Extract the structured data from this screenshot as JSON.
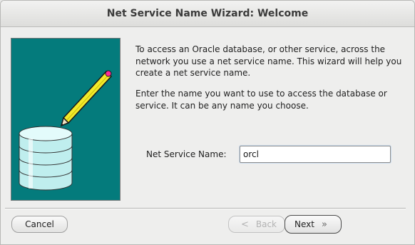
{
  "window": {
    "title": "Net Service Name Wizard: Welcome"
  },
  "intro": {
    "paragraph1": "To access an Oracle database, or other service, across the\nnetwork you use a net service name.  This wizard will help you\ncreate a net service name.",
    "paragraph2": "Enter the name you want to use to access the database or\nservice.  It can be any name you choose."
  },
  "form": {
    "net_service_name_label": "Net Service Name:",
    "net_service_name_value": "orcl"
  },
  "buttons": {
    "cancel": "Cancel",
    "back": "Back",
    "back_glyph": "<",
    "next": "Next",
    "next_glyph": "»"
  },
  "icons": {
    "art": "database-pencil-illustration"
  },
  "colors": {
    "art_background": "#047b7c",
    "pencil_body": "#f2ea2a",
    "pencil_tip": "#ff2a9a",
    "database": "#bfeeee"
  }
}
